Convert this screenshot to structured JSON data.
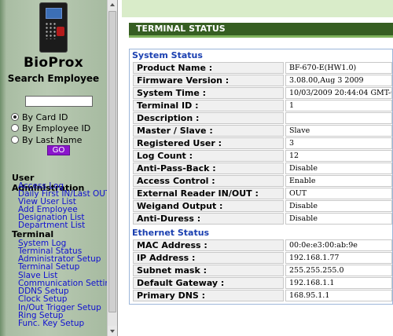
{
  "sidebar": {
    "brand_title": "BioProx",
    "brand_subtitle": "Search Employee",
    "search_value": "",
    "search_options": [
      {
        "label": "By Card ID",
        "selected": true
      },
      {
        "label": "By Employee ID",
        "selected": false
      },
      {
        "label": "By Last Name",
        "selected": false
      }
    ],
    "go_label": "GO",
    "user_admin_heading": "User Administration",
    "user_admin_links": [
      "Access Log",
      "Daily First IN/Last OUT",
      "View User List",
      "Add Employee",
      "Designation List",
      "Department List"
    ],
    "terminal_heading": "Terminal",
    "terminal_links": [
      "System Log",
      "Terminal Status",
      "Administrator Setup",
      "Terminal Setup",
      "Slave List",
      "Communication Setting",
      "DDNS Setup",
      "Clock Setup",
      "In/Out Trigger Setup",
      "Ring Setup",
      "Func. Key Setup"
    ]
  },
  "main": {
    "section_title": "TERMINAL STATUS",
    "system_status_heading": "System Status",
    "system_rows": [
      {
        "label": "Product Name :",
        "value": "BF-670-E(HW1.0)"
      },
      {
        "label": "Firmware Version :",
        "value": "3.08.00,Aug 3 2009"
      },
      {
        "label": "System Time :",
        "value": "10/03/2009 20:44:04 GMT-05"
      },
      {
        "label": "Terminal ID :",
        "value": "1"
      },
      {
        "label": "Description :",
        "value": ""
      },
      {
        "label": "Master / Slave :",
        "value": "Slave"
      },
      {
        "label": "Registered User :",
        "value": "3"
      },
      {
        "label": "Log Count :",
        "value": "12"
      },
      {
        "label": "Anti-Pass-Back :",
        "value": "Disable"
      },
      {
        "label": "Access Control :",
        "value": "Enable"
      },
      {
        "label": "External Reader IN/OUT :",
        "value": "OUT"
      },
      {
        "label": "Weigand Output :",
        "value": "Disable"
      },
      {
        "label": "Anti-Duress :",
        "value": "Disable"
      }
    ],
    "ethernet_status_heading": "Ethernet Status",
    "ethernet_rows": [
      {
        "label": "MAC Address :",
        "value": "00:0e:e3:00:ab:9e"
      },
      {
        "label": "IP Address :",
        "value": "192.168.1.77"
      },
      {
        "label": "Subnet mask :",
        "value": "255.255.255.0"
      },
      {
        "label": "Default Gateway :",
        "value": "192.168.1.1"
      },
      {
        "label": "Primary DNS :",
        "value": "168.95.1.1"
      }
    ]
  },
  "colors": {
    "section_bar": "#365e22",
    "group_heading": "#1a3fb0",
    "menu_link": "#1010d0",
    "go_button": "#8a15cc"
  }
}
